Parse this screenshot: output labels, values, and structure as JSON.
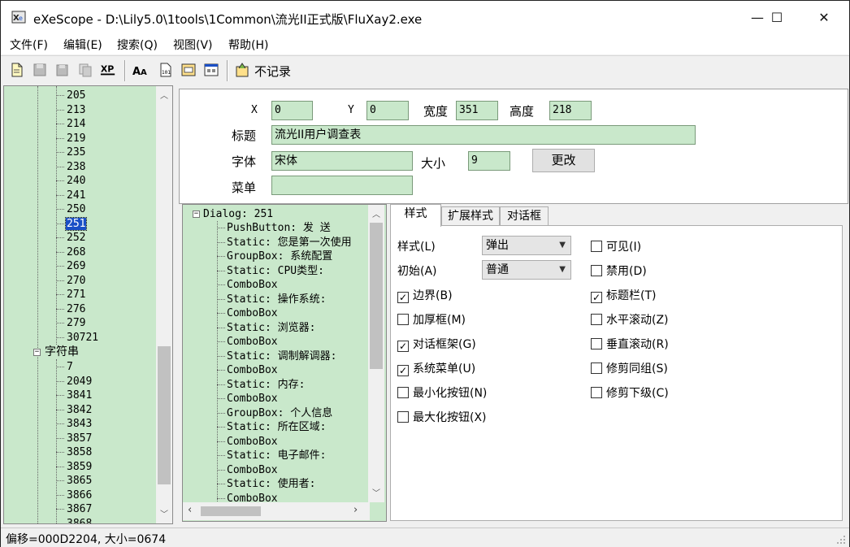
{
  "window": {
    "title": "eXeScope - D:\\Lily5.0\\1tools\\1Common\\流光II正式版\\FluXay2.exe",
    "controls": {
      "minimize": "—",
      "maximize": "☐",
      "close": "✕"
    }
  },
  "menu": [
    "文件(F)",
    "编辑(E)",
    "搜索(Q)",
    "视图(V)",
    "帮助(H)"
  ],
  "toolbar": {
    "xp_label": "XP",
    "log_label": "不记录"
  },
  "tree": {
    "items": [
      "205",
      "213",
      "214",
      "219",
      "235",
      "238",
      "240",
      "241",
      "250",
      "251",
      "252",
      "268",
      "269",
      "270",
      "271",
      "276",
      "279",
      "30721"
    ],
    "selected": "251",
    "group_label": "字符串",
    "group_items": [
      "7",
      "2049",
      "3841",
      "3842",
      "3843",
      "3857",
      "3858",
      "3859",
      "3865",
      "3866",
      "3867",
      "3868"
    ]
  },
  "props": {
    "x_label": "X",
    "x_value": "0",
    "y_label": "Y",
    "y_value": "0",
    "width_label": "宽度",
    "width_value": "351",
    "height_label": "高度",
    "height_value": "218",
    "caption_label": "标题",
    "caption_value": "流光II用户调查表",
    "font_label": "字体",
    "font_value": "宋体",
    "size_label": "大小",
    "size_value": "9",
    "change_button": "更改",
    "menu_label": "菜单",
    "menu_value": ""
  },
  "dialog_tree": {
    "root": "Dialog: 251",
    "items": [
      "PushButton: 发  送",
      "Static: 您是第一次使用",
      "GroupBox: 系统配置",
      "Static: CPU类型:",
      "ComboBox",
      "Static: 操作系统:",
      "ComboBox",
      "Static: 浏览器:",
      "ComboBox",
      "Static: 调制解调器:",
      "ComboBox",
      "Static: 内存:",
      "ComboBox",
      "GroupBox: 个人信息",
      "Static: 所在区域:",
      "ComboBox",
      "Static: 电子邮件:",
      "ComboBox",
      "Static: 使用者:",
      "ComboBox"
    ]
  },
  "tabs": [
    "样式",
    "扩展样式",
    "对话框"
  ],
  "style_tab": {
    "style_label": "样式(L)",
    "style_value": "弹出",
    "init_label": "初始(A)",
    "init_value": "普通",
    "left_checks": [
      {
        "label": "边界(B)",
        "checked": true
      },
      {
        "label": "加厚框(M)",
        "checked": false
      },
      {
        "label": "对话框架(G)",
        "checked": true
      },
      {
        "label": "系统菜单(U)",
        "checked": true
      },
      {
        "label": "最小化按钮(N)",
        "checked": false
      },
      {
        "label": "最大化按钮(X)",
        "checked": false
      }
    ],
    "right_checks": [
      {
        "label": "可见(I)",
        "checked": false
      },
      {
        "label": "禁用(D)",
        "checked": false
      },
      {
        "label": "标题栏(T)",
        "checked": true
      },
      {
        "label": "水平滚动(Z)",
        "checked": false
      },
      {
        "label": "垂直滚动(R)",
        "checked": false
      },
      {
        "label": "修剪同组(S)",
        "checked": false
      },
      {
        "label": "修剪下级(C)",
        "checked": false
      }
    ],
    "check_mark": "✓"
  },
  "status": {
    "text": "偏移=000D2204, 大小=0674"
  },
  "colors": {
    "tree_bg": "#c9e8cb",
    "selection": "#1a4fc6"
  }
}
